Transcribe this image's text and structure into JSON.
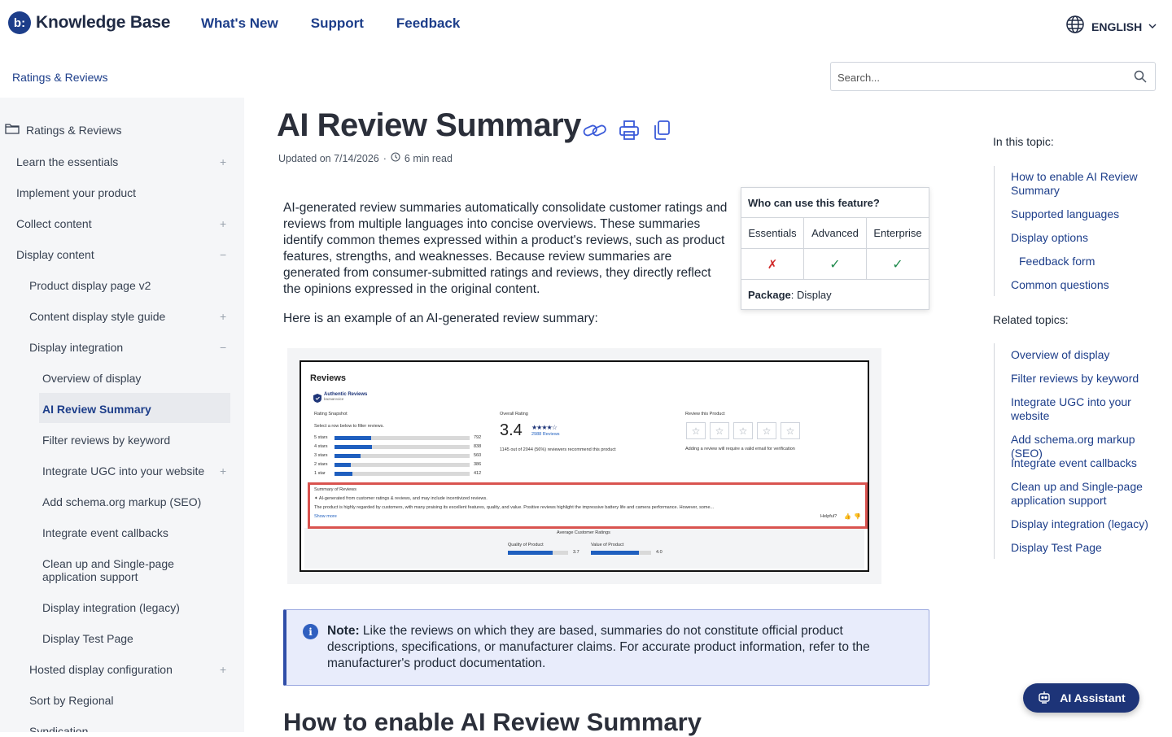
{
  "header": {
    "logo_mark": "b:",
    "logo_text": "Knowledge Base",
    "nav": [
      "What's New",
      "Support",
      "Feedback"
    ],
    "language": "ENGLISH"
  },
  "subbar": {
    "breadcrumb": "Ratings & Reviews",
    "search_placeholder": "Search..."
  },
  "sidebar": {
    "root": "Ratings & Reviews",
    "items": [
      "Learn the essentials",
      "Implement your product",
      "Collect content",
      "Display content",
      "Product display page v2",
      "Content display style guide",
      "Display integration",
      "Overview of display",
      "AI Review Summary",
      "Filter reviews by keyword",
      "Integrate UGC into your website",
      "Add schema.org markup (SEO)",
      "Integrate event callbacks",
      "Clean up and Single-page application support",
      "Display integration (legacy)",
      "Display Test Page",
      "Hosted display configuration",
      "Sort by Regional",
      "Syndication"
    ],
    "toggles": [
      "+",
      "+",
      "−",
      "+",
      "−",
      "+",
      "+"
    ]
  },
  "article": {
    "title": "AI Review Summary",
    "updated": "Updated on 7/14/2026",
    "separator": "·",
    "read_time": "6 min read",
    "intro": "AI-generated review summaries automatically consolidate customer ratings and reviews from multiple languages into concise overviews. These summaries identify common themes expressed within a product's reviews, such as product features, strengths, and weaknesses. Because review summaries are generated from consumer-submitted ratings and reviews, they directly reflect the opinions expressed in the original content.",
    "example_intro": "Here is an example of an AI-generated review summary:",
    "note_label": "Note:",
    "note_text": "Like the reviews on which they are based, summaries do not constitute official product descriptions, specifications, or manufacturer claims. For accurate product information,  refer to the manufacturer's product documentation.",
    "h2": "How to enable AI Review Summary"
  },
  "feature_table": {
    "heading": "Who can use this feature?",
    "columns": [
      "Essentials",
      "Advanced",
      "Enterprise"
    ],
    "availability": [
      "✗",
      "✓",
      "✓"
    ],
    "package_label": "Package",
    "package_value": ": Display"
  },
  "example_image": {
    "reviews_title": "Reviews",
    "authentic": "Authentic Reviews",
    "brand": "bazaarvoice",
    "rating_snapshot": "Rating Snapshot",
    "filter_hint": "Select a row below to filter reviews.",
    "star_rows": [
      {
        "label": "5 stars",
        "count": "792",
        "fill": 0.27
      },
      {
        "label": "4 stars",
        "count": "838",
        "fill": 0.28
      },
      {
        "label": "3 stars",
        "count": "560",
        "fill": 0.19
      },
      {
        "label": "2 stars",
        "count": "386",
        "fill": 0.12
      },
      {
        "label": "1 star",
        "count": "412",
        "fill": 0.13
      }
    ],
    "overall_label": "Overall Rating",
    "overall_value": "3.4",
    "review_count": "2988 Reviews",
    "recommend": "1145 out of 2044 (56%) reviewers recommend this product",
    "review_this": "Review this Product",
    "review_hint": "Adding a review will require a valid email for verification",
    "summary_title": "Summary of Reviews",
    "summary_disclaimer": "AI-generated from customer ratings & reviews, and may include incentivized reviews.",
    "summary_text": "The product is highly regarded by customers, with many praising its excellent features, quality, and value. Positive reviews highlight the impressive battery life and camera performance. However, some...",
    "show_more": "Show more",
    "helpful": "Helpful?",
    "avg_ratings": "Average Customer Ratings",
    "quality_label": "Quality of Product",
    "quality_value": "3.7",
    "quality_fill": 0.74,
    "value_label": "Value of Product",
    "value_value": "4.0",
    "value_fill": 0.8
  },
  "rail": {
    "in_topic": "In this topic:",
    "topic_links": [
      "How to enable AI Review Summary",
      "Supported languages",
      "Display options",
      "Feedback form",
      "Common questions"
    ],
    "related": "Related topics:",
    "related_links": [
      "Overview of display",
      "Filter reviews by keyword",
      "Integrate UGC into your website",
      "Add schema.org markup (SEO)",
      "Integrate event callbacks",
      "Clean up and Single-page application support",
      "Display integration (legacy)",
      "Display Test Page"
    ]
  },
  "assistant": {
    "label": "AI Assistant"
  },
  "colors": {
    "brand": "#1d3e8a",
    "note_bg": "#e8ecfb",
    "highlight": "#d9534f"
  }
}
